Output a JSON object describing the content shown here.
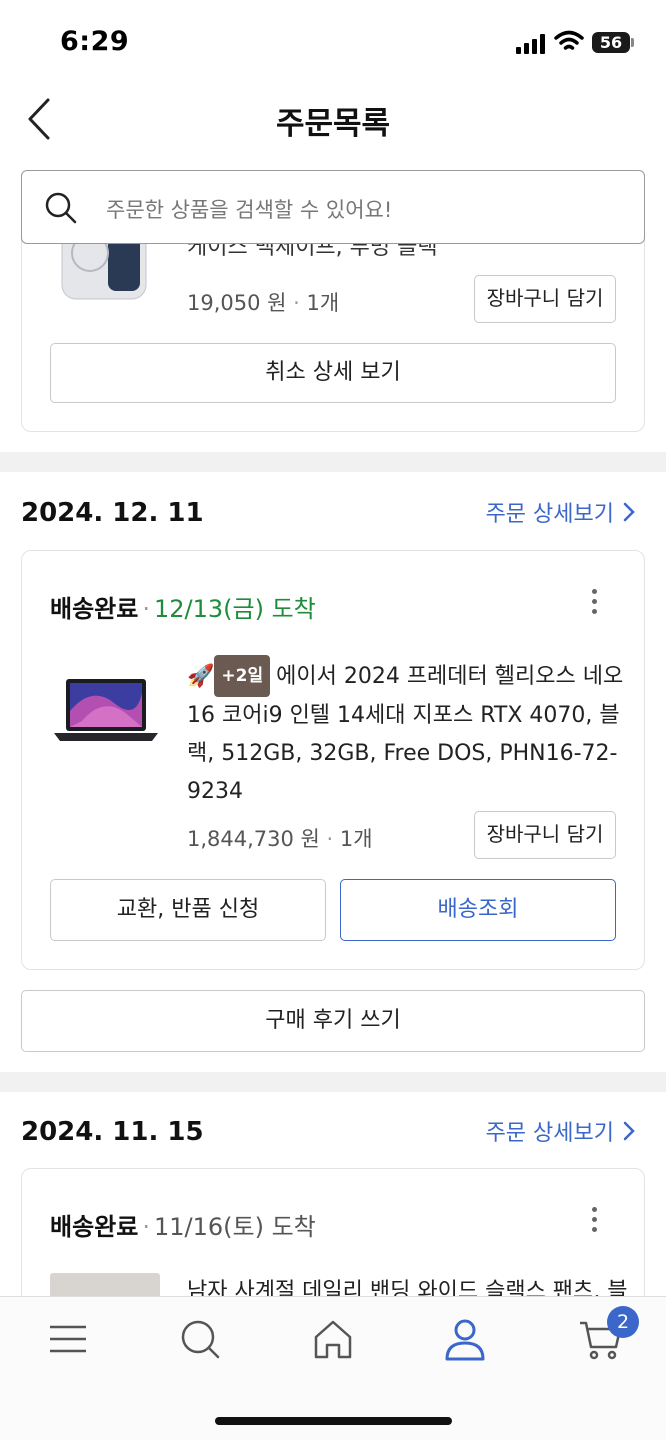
{
  "status_bar": {
    "time": "6:29",
    "battery": "56"
  },
  "header": {
    "title": "주문목록"
  },
  "search": {
    "placeholder": "주문한 상품을 검색할 수 있어요!"
  },
  "order0": {
    "title_partial": "케이스 맥세이프, 투명 블랙",
    "price": "19,050 원",
    "qty": "1개",
    "cart_button": "장바구니 담기",
    "cancel_detail_button": "취소 상세 보기"
  },
  "order1": {
    "date": "2024. 12. 11",
    "detail_link": "주문 상세보기",
    "status": "배송완료",
    "arrival": "12/13(금) 도착",
    "badge": "+2일",
    "title_line1": "에이서 2024 프레데터 헬리오스 네오",
    "title_line2": "16 코어i9 인텔 14세대 지포스 RTX 4070, 블",
    "title_line3": "랙, 512GB, 32GB, Free DOS, PHN16-72-",
    "title_line4": "9234",
    "price": "1,844,730 원",
    "qty": "1개",
    "cart_button": "장바구니 담기",
    "exchange_button": "교환, 반품 신청",
    "tracking_button": "배송조회",
    "review_button": "구매 후기 쓰기"
  },
  "order2": {
    "date": "2024. 11. 15",
    "detail_link": "주문 상세보기",
    "status": "배송완료",
    "arrival": "11/16(토) 도착",
    "title_partial": "남자 사계절 데일리 밴딩 와이드 슬랙스 팬츠, 블"
  },
  "tab_bar": {
    "items": [
      "menu-icon",
      "search-icon",
      "home-icon",
      "user-icon",
      "cart-icon"
    ],
    "active": "user-icon",
    "cart_count": "2"
  },
  "colors": {
    "accent": "#3a67c9",
    "arrival_green": "#1e8c3a",
    "badge_brown": "#6b5a52"
  }
}
